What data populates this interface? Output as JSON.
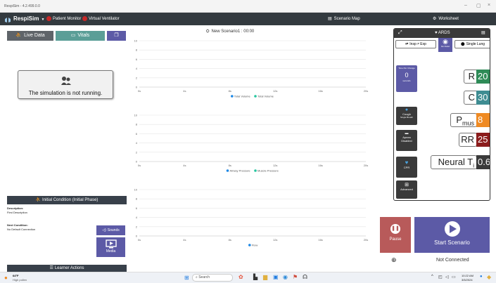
{
  "window": {
    "title": "RespiSim - 4.2.499.0.0"
  },
  "appbar": {
    "brand": "RespiSim",
    "patient_monitor": "Patient Monitor",
    "virtual_ventilator": "Virtual Ventilator",
    "scenario_name": "New Scenario1 : 00:00",
    "scenario_map": "Scenario Map",
    "worksheet": "Worksheet"
  },
  "tabs": {
    "live_data": "Live Data",
    "vitals": "Vitals"
  },
  "simulation": {
    "message": "The simulation is not running."
  },
  "initial_condition": {
    "header": "Initial Condition (Initial Phase)",
    "description_label": "Description:",
    "description_value": "First Description",
    "next_condition_label": "Next Condition:",
    "next_condition_value": "No Default Connection",
    "sounds_label": "Sounds",
    "media_label": "Media"
  },
  "learner_actions": "Learner Actions",
  "charts": [
    {
      "yticks": [
        "10",
        "8",
        "6",
        "4",
        "2",
        "0"
      ],
      "xticks": [
        "0s",
        "4s",
        "8s",
        "12s",
        "16s",
        "20s"
      ],
      "legend": [
        {
          "name": "Total Volume",
          "color": "#1e88e5"
        },
        {
          "name": "Total Volume",
          "color": "#26c6a0"
        }
      ]
    },
    {
      "yticks": [
        "10",
        "8",
        "6",
        "4",
        "2",
        "0"
      ],
      "xticks": [
        "0s",
        "4s",
        "8s",
        "12s",
        "16s",
        "20s"
      ],
      "legend": [
        {
          "name": "Airway Pressure",
          "color": "#1e88e5"
        },
        {
          "name": "Muscle Pressure",
          "color": "#26c6a0"
        }
      ]
    },
    {
      "yticks": [
        "10",
        "8",
        "6",
        "4",
        "2",
        "0"
      ],
      "xticks": [
        "0s",
        "4s",
        "8s",
        "12s",
        "16s",
        "20s"
      ],
      "legend": [
        {
          "name": "Flow",
          "color": "#1e88e5"
        }
      ]
    }
  ],
  "right_panel": {
    "title": "ARDS",
    "insp_exp": "Insp ≠ Exp",
    "breath_hold_label": "Run Model",
    "single_lung": "Single Lung",
    "time_per_change_label": "Time Per Change",
    "time_per_change_value": "0",
    "time_per_change_unit": "seconds",
    "cough": "Cough",
    "cough_sub": "Single Breath",
    "apnea": "Apnea",
    "apnea_sub": "Disabled",
    "cpr": "CPR",
    "advanced": "Advanced",
    "params": {
      "R_label": "R",
      "R_value": "20",
      "C_label": "C",
      "C_value": "30",
      "Pmus_label": "P",
      "Pmus_sub": "mus",
      "Pmus_value": "8",
      "RR_label": "RR",
      "RR_value": "25",
      "NeuralTi_label": "Neural T",
      "NeuralTi_sub": "i",
      "NeuralTi_value": "0.6"
    }
  },
  "controls": {
    "pause": "Pause",
    "start": "Start Scenario",
    "connection": "Not Connected"
  },
  "taskbar": {
    "weather_temp": "64°F",
    "weather_desc": "High pollen",
    "search": "Search",
    "time": "10:22 AM",
    "date": "3/5/2024"
  },
  "colors": {
    "appbar": "#333a3f",
    "tab_live": "#5f6469",
    "tab_vitals": "#5b9e97",
    "tab_extra": "#5c5aa6",
    "purple": "#5c5aa6",
    "orange": "#ef8a22",
    "teal": "#3e8c92",
    "red": "#8b1c1c",
    "dark": "#3a3a3a",
    "green": "#2e8b57",
    "pause": "#b85a5a"
  }
}
